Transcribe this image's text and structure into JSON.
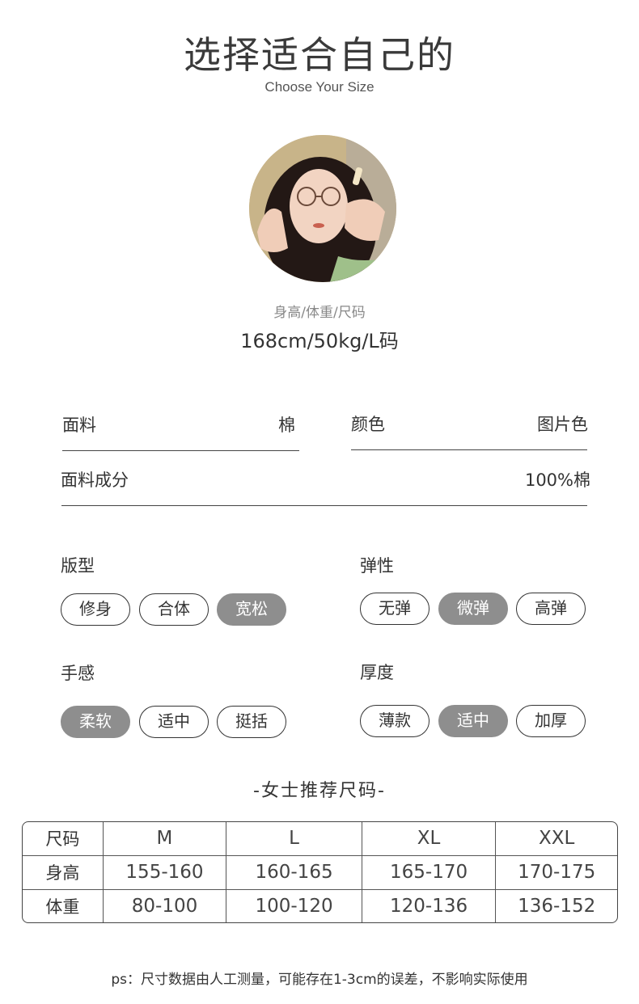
{
  "header": {
    "title": "选择适合自己的",
    "subtitle": "Choose Your Size"
  },
  "model": {
    "caption_label": "身高/体重/尺码",
    "caption_value": "168cm/50kg/L码"
  },
  "specs": {
    "fabric_label": "面料",
    "fabric_value": "棉",
    "color_label": "颜色",
    "color_value": "图片色",
    "composition_label": "面料成分",
    "composition_value": "100%棉"
  },
  "attributes": {
    "fit": {
      "label": "版型",
      "options": [
        "修身",
        "合体",
        "宽松"
      ],
      "selected": "宽松"
    },
    "elasticity": {
      "label": "弹性",
      "options": [
        "无弹",
        "微弹",
        "高弹"
      ],
      "selected": "微弹"
    },
    "feel": {
      "label": "手感",
      "options": [
        "柔软",
        "适中",
        "挺括"
      ],
      "selected": "柔软"
    },
    "thickness": {
      "label": "厚度",
      "options": [
        "薄款",
        "适中",
        "加厚"
      ],
      "selected": "适中"
    }
  },
  "size_table": {
    "title": "-女士推荐尺码-",
    "header": [
      "尺码",
      "M",
      "L",
      "XL",
      "XXL"
    ],
    "rows": [
      [
        "身高",
        "155-160",
        "160-165",
        "165-170",
        "170-175"
      ],
      [
        "体重",
        "80-100",
        "100-120",
        "120-136",
        "136-152"
      ]
    ]
  },
  "note": "ps：尺寸数据由人工测量，可能存在1-3cm的误差，不影响实际使用",
  "colors": {
    "selected_pill": "#8e8e8e",
    "line": "#444444"
  }
}
